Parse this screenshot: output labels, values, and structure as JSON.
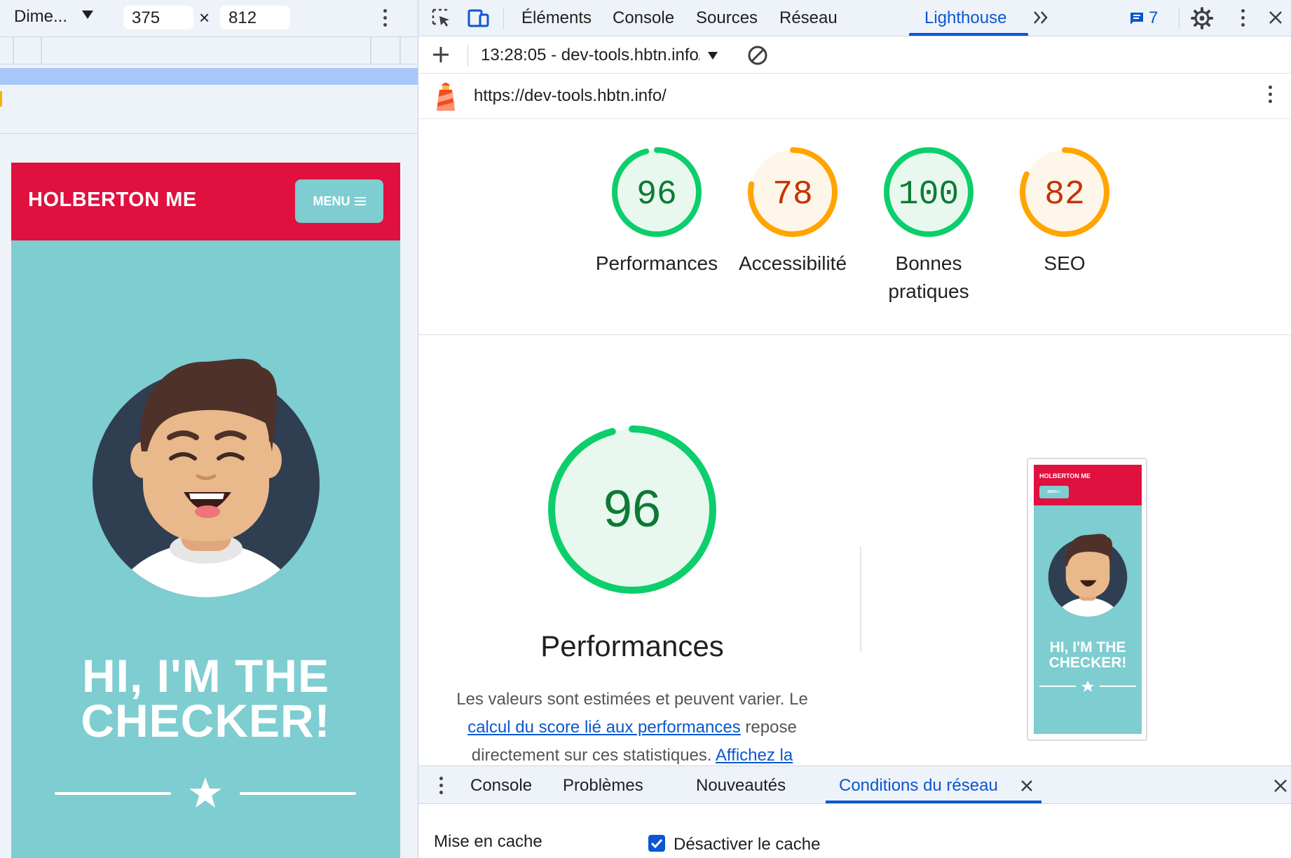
{
  "device_toolbar": {
    "dimension_preset": "Dime...",
    "width_value": "375",
    "times_symbol": "×",
    "height_value": "812"
  },
  "page": {
    "brand": "HOLBERTON ME",
    "menu_label": "MENU",
    "hero_line1": "HI, I'M THE",
    "hero_line2": "CHECKER!"
  },
  "devtools": {
    "tabs": [
      "Éléments",
      "Console",
      "Sources",
      "Réseau",
      "Lighthouse"
    ],
    "active_tab": "Lighthouse",
    "issues_count": "7",
    "accent_color": "#0b57d0"
  },
  "lighthouse": {
    "report_select": "13:28:05 - dev-tools.hbtn.info/",
    "url": "https://dev-tools.hbtn.info/",
    "gauges": [
      {
        "score": "96",
        "label": "Performances",
        "status": "pass",
        "color": "#0c7a35",
        "ring": "#0cce6b",
        "fraction": 0.96
      },
      {
        "score": "78",
        "label": "Accessibilité",
        "status": "average",
        "color": "#c33300",
        "ring": "#ffa400",
        "fraction": 0.78
      },
      {
        "score": "100",
        "label_line1": "Bonnes",
        "label_line2": "pratiques",
        "status": "pass",
        "color": "#0c7a35",
        "ring": "#0cce6b",
        "fraction": 1.0
      },
      {
        "score": "82",
        "label": "SEO",
        "status": "average",
        "color": "#c33300",
        "ring": "#ffa400",
        "fraction": 0.82
      }
    ],
    "performance": {
      "score": "96",
      "fraction": 0.96,
      "title": "Performances",
      "desc_part1": "Les valeurs sont estimées et peuvent varier. Le",
      "desc_link1": "calcul du score lié aux performances",
      "desc_part2": "repose directement sur ces statistiques.",
      "desc_link2": "Affichez la"
    },
    "thumbnail": {
      "brand": "HOLBERTON ME",
      "menu": "MENU ≡",
      "title_line1": "HI, I'M THE",
      "title_line2": "CHECKER!"
    }
  },
  "drawer": {
    "tabs": [
      "Console",
      "Problèmes",
      "Nouveautés",
      "Conditions du réseau"
    ],
    "active_tab": "Conditions du réseau",
    "cache_label": "Mise en cache",
    "cache_checkbox_label": "Désactiver le cache",
    "cache_checked": true
  }
}
